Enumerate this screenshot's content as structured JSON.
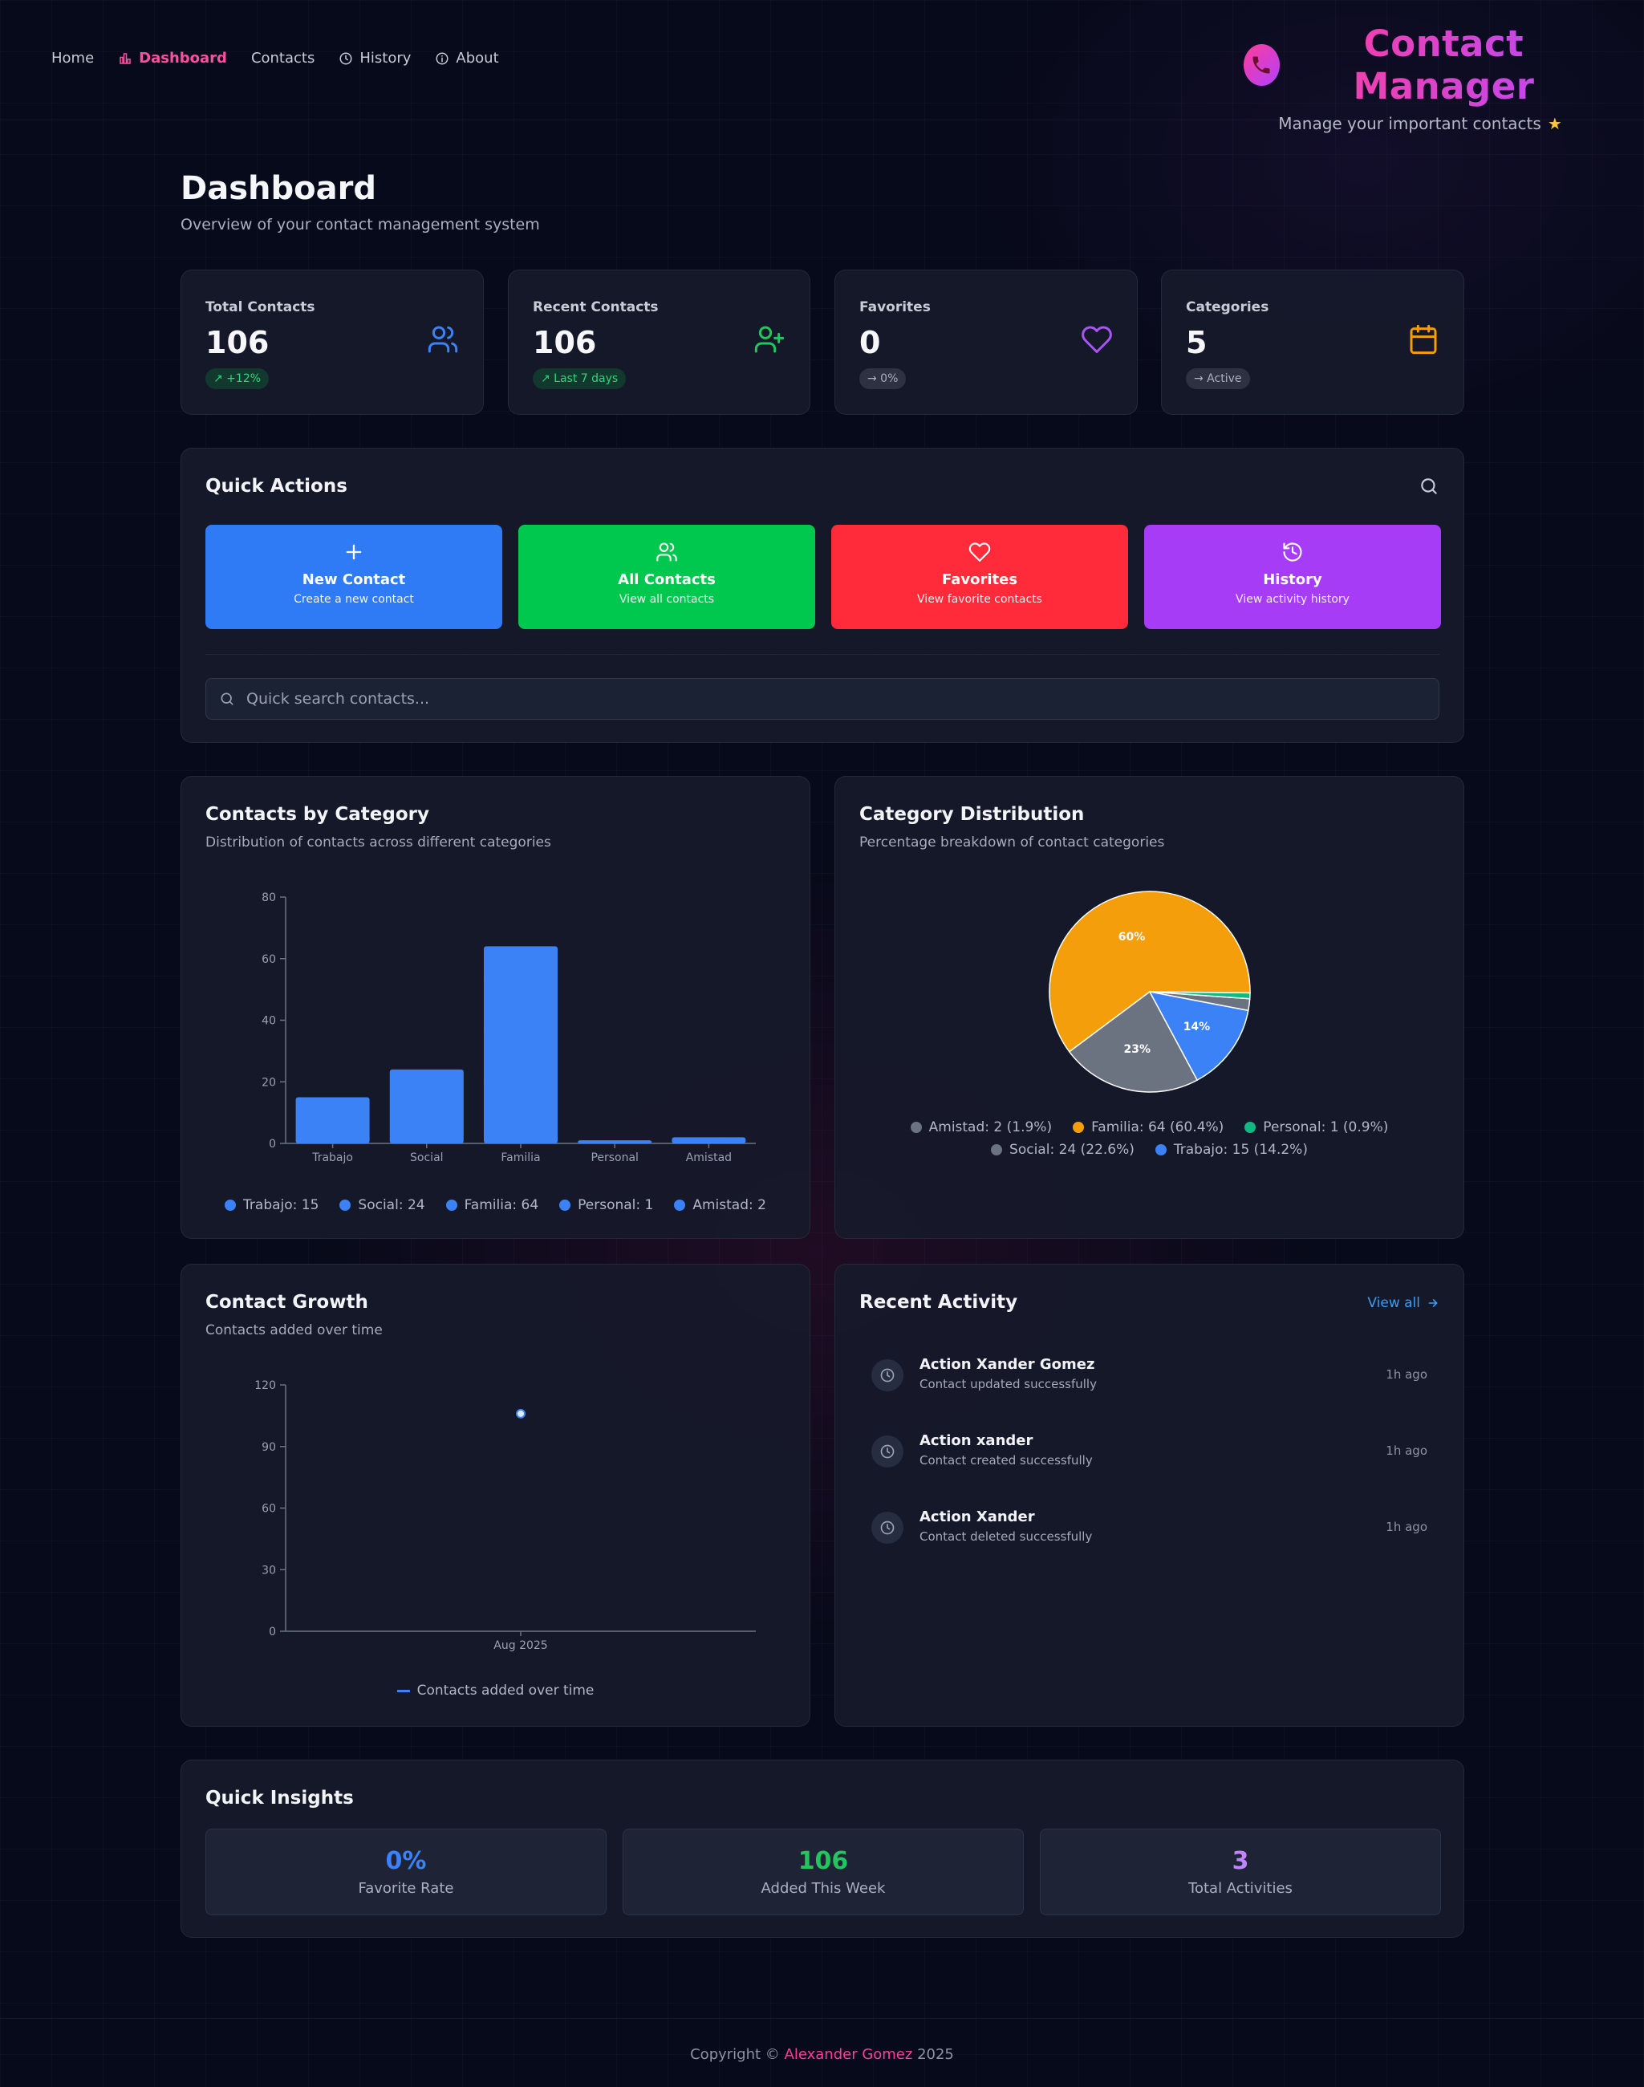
{
  "nav": {
    "items": [
      {
        "label": "Home",
        "icon": "none"
      },
      {
        "label": "Dashboard",
        "icon": "bar-chart-icon"
      },
      {
        "label": "Contacts",
        "icon": "none"
      },
      {
        "label": "History",
        "icon": "clock-icon"
      },
      {
        "label": "About",
        "icon": "info-icon"
      }
    ],
    "active": "Dashboard",
    "active_color": "#ff4fa0"
  },
  "brand": {
    "title": "Contact Manager",
    "subtitle": "Manage your important contacts",
    "star": "★",
    "icon": "phone-icon"
  },
  "page": {
    "title": "Dashboard",
    "subtitle": "Overview of your contact management system"
  },
  "stats": [
    {
      "label": "Total Contacts",
      "value": "106",
      "badge": "↗ +12%",
      "icon": "users-icon",
      "color": "#3b82f6"
    },
    {
      "label": "Recent Contacts",
      "value": "106",
      "badge": "↗ Last 7 days",
      "icon": "user-plus-icon",
      "color": "#22c55e"
    },
    {
      "label": "Favorites",
      "value": "0",
      "badge": "→ 0%",
      "icon": "heart-icon",
      "color": "#a855f7"
    },
    {
      "label": "Categories",
      "value": "5",
      "badge": "→ Active",
      "icon": "calendar-icon",
      "color": "#f59e0b"
    }
  ],
  "quick_actions": {
    "title": "Quick Actions",
    "buttons": [
      {
        "title": "New Contact",
        "subtitle": "Create a new contact",
        "icon": "plus-icon",
        "color": "#2f7bf6"
      },
      {
        "title": "All Contacts",
        "subtitle": "View all contacts",
        "icon": "users-icon",
        "color": "#00c74e"
      },
      {
        "title": "Favorites",
        "subtitle": "View favorite contacts",
        "icon": "heart-icon",
        "color": "#ff2b3a"
      },
      {
        "title": "History",
        "subtitle": "View activity history",
        "icon": "history-icon",
        "color": "#a63cf6"
      }
    ],
    "search_placeholder": "Quick search contacts..."
  },
  "category_chart": {
    "title": "Contacts by Category",
    "subtitle": "Distribution of contacts across different categories",
    "legend": [
      "Trabajo: 15",
      "Social: 24",
      "Familia: 64",
      "Personal: 1",
      "Amistad: 2"
    ]
  },
  "distribution_chart": {
    "title": "Category Distribution",
    "subtitle": "Percentage breakdown of contact categories",
    "legend": [
      "Amistad: 2 (1.9%)",
      "Familia: 64 (60.4%)",
      "Personal: 1 (0.9%)",
      "Social: 24 (22.6%)",
      "Trabajo: 15 (14.2%)"
    ]
  },
  "growth_chart": {
    "title": "Contact Growth",
    "subtitle": "Contacts added over time",
    "legend": "Contacts added over time"
  },
  "chart_data": [
    {
      "type": "bar",
      "categories": [
        "Trabajo",
        "Social",
        "Familia",
        "Personal",
        "Amistad"
      ],
      "values": [
        15,
        24,
        64,
        1,
        2
      ],
      "ylim": [
        0,
        80
      ],
      "yticks": [
        0,
        20,
        40,
        60,
        80
      ],
      "color": "#3b82f6",
      "grid": false
    },
    {
      "type": "pie",
      "categories": [
        "Amistad",
        "Familia",
        "Personal",
        "Social",
        "Trabajo"
      ],
      "values": [
        2,
        64,
        1,
        24,
        15
      ],
      "percent_labels": [
        "",
        "60%",
        "",
        "23%",
        "14%"
      ],
      "colors": [
        "#6b7280",
        "#f59e0b",
        "#10b981",
        "#6b7280",
        "#3b82f6"
      ]
    },
    {
      "type": "line",
      "x": [
        "Aug 2025"
      ],
      "y": [
        106
      ],
      "ylim": [
        0,
        120
      ],
      "yticks": [
        0,
        30,
        60,
        90,
        120
      ],
      "color": "#3b82f6",
      "series_name": "Contacts added over time"
    }
  ],
  "recent_activity": {
    "title": "Recent Activity",
    "view_all": "View all",
    "items": [
      {
        "title": "Action Xander Gomez",
        "subtitle": "Contact updated successfully",
        "time": "1h ago"
      },
      {
        "title": "Action xander",
        "subtitle": "Contact created successfully",
        "time": "1h ago"
      },
      {
        "title": "Action Xander",
        "subtitle": "Contact deleted successfully",
        "time": "1h ago"
      }
    ]
  },
  "insights": {
    "title": "Quick Insights",
    "items": [
      {
        "value": "0%",
        "label": "Favorite Rate",
        "color": "#3b82f6"
      },
      {
        "value": "106",
        "label": "Added This Week",
        "color": "#22c55e"
      },
      {
        "value": "3",
        "label": "Total Activities",
        "color": "#c084fc"
      }
    ]
  },
  "footer": {
    "prefix": "Copyright ©",
    "author": "Alexander Gomez",
    "year": "2025"
  }
}
